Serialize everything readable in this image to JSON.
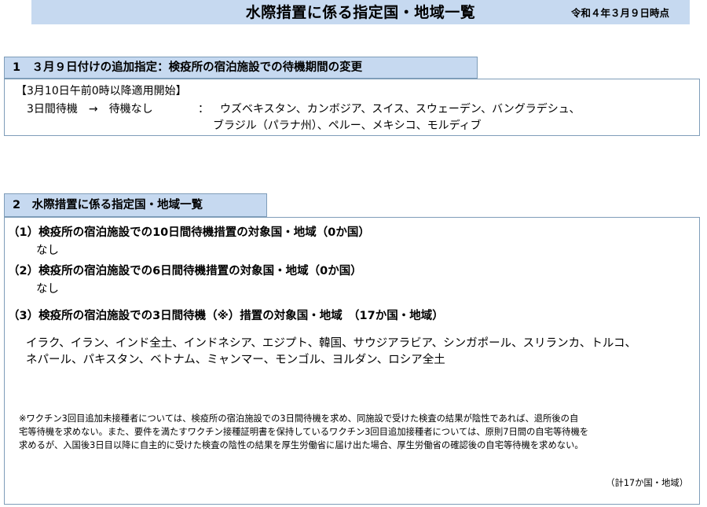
{
  "header": {
    "title": "水際措置に係る指定国・地域一覧",
    "date": "令和４年３月９日時点"
  },
  "section1": {
    "heading": "1　３月９日付けの追加指定：検疫所の宿泊施設での待機期間の変更",
    "bracket_label": "【3月10日午前0時以降適用開始】",
    "change_label": "3日間待機　→　待機なし",
    "colon": "：",
    "countries_line1": "ウズベキスタン、カンボジア、スイス、スウェーデン、バングラデシュ、",
    "countries_line2": "ブラジル（パラナ州）、ペルー、メキシコ、モルディブ"
  },
  "section2": {
    "heading": "2　水際措置に係る指定国・地域一覧",
    "items": [
      {
        "title": "（1）検疫所の宿泊施設での10日間待機措置の対象国・地域（0か国）",
        "body": "なし"
      },
      {
        "title": "（2）検疫所の宿泊施設での6日間待機措置の対象国・地域（0か国）",
        "body": "なし"
      },
      {
        "title": "（3）検疫所の宿泊施設での3日間待機（※）措置の対象国・地域　（17か国・地域）"
      }
    ],
    "countries_line1": "イラク、イラン、インド全土、インドネシア、エジプト、韓国、サウジアラビア、シンガポール、スリランカ、トルコ、",
    "countries_line2": "ネパール、パキスタン、ベトナム、ミャンマー、モンゴル、ヨルダン、ロシア全土",
    "note_lines": [
      "※ワクチン3回目追加未接種者については、検疫所の宿泊施設での3日間待機を求め、同施設で受けた検査の結果が陰性であれば、退所後の自",
      "宅等待機を求めない。また、要件を満たすワクチン接種証明書を保持しているワクチン3回目追加接種者については、原則7日間の自宅等待機を",
      "求めるが、入国後3日目以降に自主的に受けた検査の陰性の結果を厚生労働省に届け出た場合、厚生労働省の確認後の自宅等待機を求めない。"
    ],
    "total": "（計17か国・地域）"
  }
}
